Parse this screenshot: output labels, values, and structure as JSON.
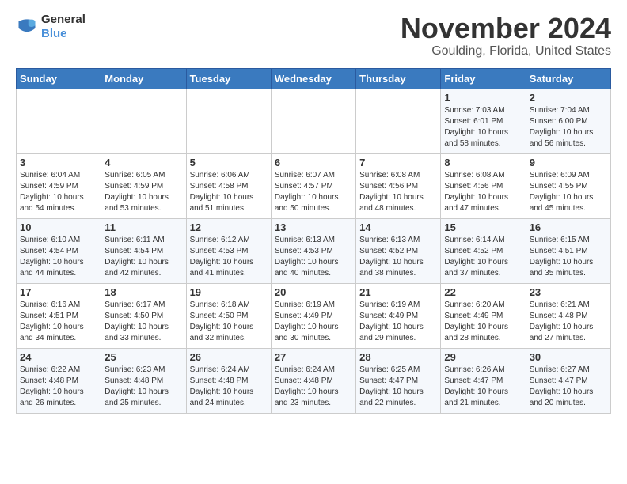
{
  "logo": {
    "general": "General",
    "blue": "Blue"
  },
  "header": {
    "month": "November 2024",
    "location": "Goulding, Florida, United States"
  },
  "weekdays": [
    "Sunday",
    "Monday",
    "Tuesday",
    "Wednesday",
    "Thursday",
    "Friday",
    "Saturday"
  ],
  "weeks": [
    [
      {
        "day": "",
        "text": ""
      },
      {
        "day": "",
        "text": ""
      },
      {
        "day": "",
        "text": ""
      },
      {
        "day": "",
        "text": ""
      },
      {
        "day": "",
        "text": ""
      },
      {
        "day": "1",
        "text": "Sunrise: 7:03 AM\nSunset: 6:01 PM\nDaylight: 10 hours and 58 minutes."
      },
      {
        "day": "2",
        "text": "Sunrise: 7:04 AM\nSunset: 6:00 PM\nDaylight: 10 hours and 56 minutes."
      }
    ],
    [
      {
        "day": "3",
        "text": "Sunrise: 6:04 AM\nSunset: 4:59 PM\nDaylight: 10 hours and 54 minutes."
      },
      {
        "day": "4",
        "text": "Sunrise: 6:05 AM\nSunset: 4:59 PM\nDaylight: 10 hours and 53 minutes."
      },
      {
        "day": "5",
        "text": "Sunrise: 6:06 AM\nSunset: 4:58 PM\nDaylight: 10 hours and 51 minutes."
      },
      {
        "day": "6",
        "text": "Sunrise: 6:07 AM\nSunset: 4:57 PM\nDaylight: 10 hours and 50 minutes."
      },
      {
        "day": "7",
        "text": "Sunrise: 6:08 AM\nSunset: 4:56 PM\nDaylight: 10 hours and 48 minutes."
      },
      {
        "day": "8",
        "text": "Sunrise: 6:08 AM\nSunset: 4:56 PM\nDaylight: 10 hours and 47 minutes."
      },
      {
        "day": "9",
        "text": "Sunrise: 6:09 AM\nSunset: 4:55 PM\nDaylight: 10 hours and 45 minutes."
      }
    ],
    [
      {
        "day": "10",
        "text": "Sunrise: 6:10 AM\nSunset: 4:54 PM\nDaylight: 10 hours and 44 minutes."
      },
      {
        "day": "11",
        "text": "Sunrise: 6:11 AM\nSunset: 4:54 PM\nDaylight: 10 hours and 42 minutes."
      },
      {
        "day": "12",
        "text": "Sunrise: 6:12 AM\nSunset: 4:53 PM\nDaylight: 10 hours and 41 minutes."
      },
      {
        "day": "13",
        "text": "Sunrise: 6:13 AM\nSunset: 4:53 PM\nDaylight: 10 hours and 40 minutes."
      },
      {
        "day": "14",
        "text": "Sunrise: 6:13 AM\nSunset: 4:52 PM\nDaylight: 10 hours and 38 minutes."
      },
      {
        "day": "15",
        "text": "Sunrise: 6:14 AM\nSunset: 4:52 PM\nDaylight: 10 hours and 37 minutes."
      },
      {
        "day": "16",
        "text": "Sunrise: 6:15 AM\nSunset: 4:51 PM\nDaylight: 10 hours and 35 minutes."
      }
    ],
    [
      {
        "day": "17",
        "text": "Sunrise: 6:16 AM\nSunset: 4:51 PM\nDaylight: 10 hours and 34 minutes."
      },
      {
        "day": "18",
        "text": "Sunrise: 6:17 AM\nSunset: 4:50 PM\nDaylight: 10 hours and 33 minutes."
      },
      {
        "day": "19",
        "text": "Sunrise: 6:18 AM\nSunset: 4:50 PM\nDaylight: 10 hours and 32 minutes."
      },
      {
        "day": "20",
        "text": "Sunrise: 6:19 AM\nSunset: 4:49 PM\nDaylight: 10 hours and 30 minutes."
      },
      {
        "day": "21",
        "text": "Sunrise: 6:19 AM\nSunset: 4:49 PM\nDaylight: 10 hours and 29 minutes."
      },
      {
        "day": "22",
        "text": "Sunrise: 6:20 AM\nSunset: 4:49 PM\nDaylight: 10 hours and 28 minutes."
      },
      {
        "day": "23",
        "text": "Sunrise: 6:21 AM\nSunset: 4:48 PM\nDaylight: 10 hours and 27 minutes."
      }
    ],
    [
      {
        "day": "24",
        "text": "Sunrise: 6:22 AM\nSunset: 4:48 PM\nDaylight: 10 hours and 26 minutes."
      },
      {
        "day": "25",
        "text": "Sunrise: 6:23 AM\nSunset: 4:48 PM\nDaylight: 10 hours and 25 minutes."
      },
      {
        "day": "26",
        "text": "Sunrise: 6:24 AM\nSunset: 4:48 PM\nDaylight: 10 hours and 24 minutes."
      },
      {
        "day": "27",
        "text": "Sunrise: 6:24 AM\nSunset: 4:48 PM\nDaylight: 10 hours and 23 minutes."
      },
      {
        "day": "28",
        "text": "Sunrise: 6:25 AM\nSunset: 4:47 PM\nDaylight: 10 hours and 22 minutes."
      },
      {
        "day": "29",
        "text": "Sunrise: 6:26 AM\nSunset: 4:47 PM\nDaylight: 10 hours and 21 minutes."
      },
      {
        "day": "30",
        "text": "Sunrise: 6:27 AM\nSunset: 4:47 PM\nDaylight: 10 hours and 20 minutes."
      }
    ]
  ]
}
